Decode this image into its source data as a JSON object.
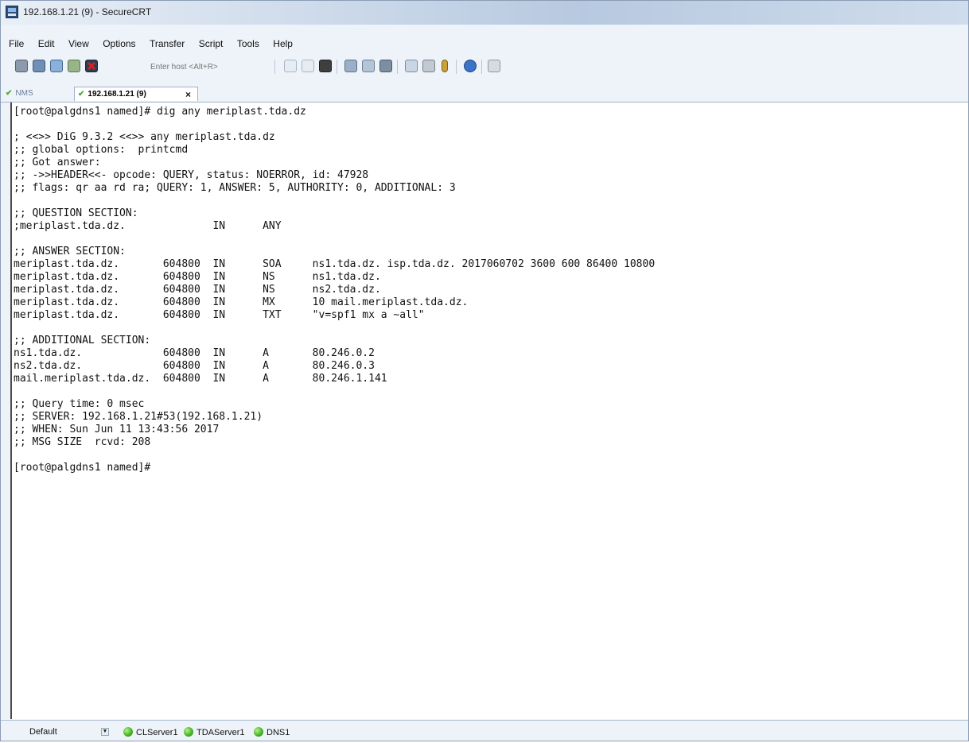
{
  "window": {
    "title": "192.168.1.21 (9) - SecureCRT"
  },
  "menu": [
    "File",
    "Edit",
    "View",
    "Options",
    "Transfer",
    "Script",
    "Tools",
    "Help"
  ],
  "toolbar": {
    "host_placeholder": "Enter host <Alt+R>",
    "icons": [
      "connect-icon",
      "quick-connect-icon",
      "connect-tab-icon",
      "reconnect-icon",
      "disconnect-icon",
      "copy-icon",
      "paste-icon",
      "find-icon",
      "print-icon",
      "print-setup-icon",
      "log-icon",
      "session-options-icon",
      "global-options-icon",
      "keymap-icon",
      "help-icon",
      "sftp-icon"
    ]
  },
  "tabs": [
    {
      "label": "NMS",
      "active": false
    },
    {
      "label": "192.168.1.21 (9)",
      "active": true,
      "close": "×"
    }
  ],
  "terminal": {
    "lines": [
      "[root@palgdns1 named]# dig any meriplast.tda.dz",
      "",
      "; <<>> DiG 9.3.2 <<>> any meriplast.tda.dz",
      ";; global options:  printcmd",
      ";; Got answer:",
      ";; ->>HEADER<<- opcode: QUERY, status: NOERROR, id: 47928",
      ";; flags: qr aa rd ra; QUERY: 1, ANSWER: 5, AUTHORITY: 0, ADDITIONAL: 3",
      "",
      ";; QUESTION SECTION:",
      ";meriplast.tda.dz.              IN      ANY",
      "",
      ";; ANSWER SECTION:",
      "meriplast.tda.dz.       604800  IN      SOA     ns1.tda.dz. isp.tda.dz. 2017060702 3600 600 86400 10800",
      "meriplast.tda.dz.       604800  IN      NS      ns1.tda.dz.",
      "meriplast.tda.dz.       604800  IN      NS      ns2.tda.dz.",
      "meriplast.tda.dz.       604800  IN      MX      10 mail.meriplast.tda.dz.",
      "meriplast.tda.dz.       604800  IN      TXT     \"v=spf1 mx a ~all\"",
      "",
      ";; ADDITIONAL SECTION:",
      "ns1.tda.dz.             604800  IN      A       80.246.0.2",
      "ns2.tda.dz.             604800  IN      A       80.246.0.3",
      "mail.meriplast.tda.dz.  604800  IN      A       80.246.1.141",
      "",
      ";; Query time: 0 msec",
      ";; SERVER: 192.168.1.21#53(192.168.1.21)",
      ";; WHEN: Sun Jun 11 13:43:56 2017",
      ";; MSG SIZE  rcvd: 208",
      "",
      "[root@palgdns1 named]#"
    ]
  },
  "statusbar": {
    "session_select": "Default",
    "servers": [
      "CLServer1",
      "TDAServer1",
      "DNS1"
    ]
  },
  "colors": {
    "terminal_bg": "#ffffff",
    "terminal_text": "#111111",
    "status_ok": "#48b629",
    "chrome_bg": "#eef3f9"
  }
}
